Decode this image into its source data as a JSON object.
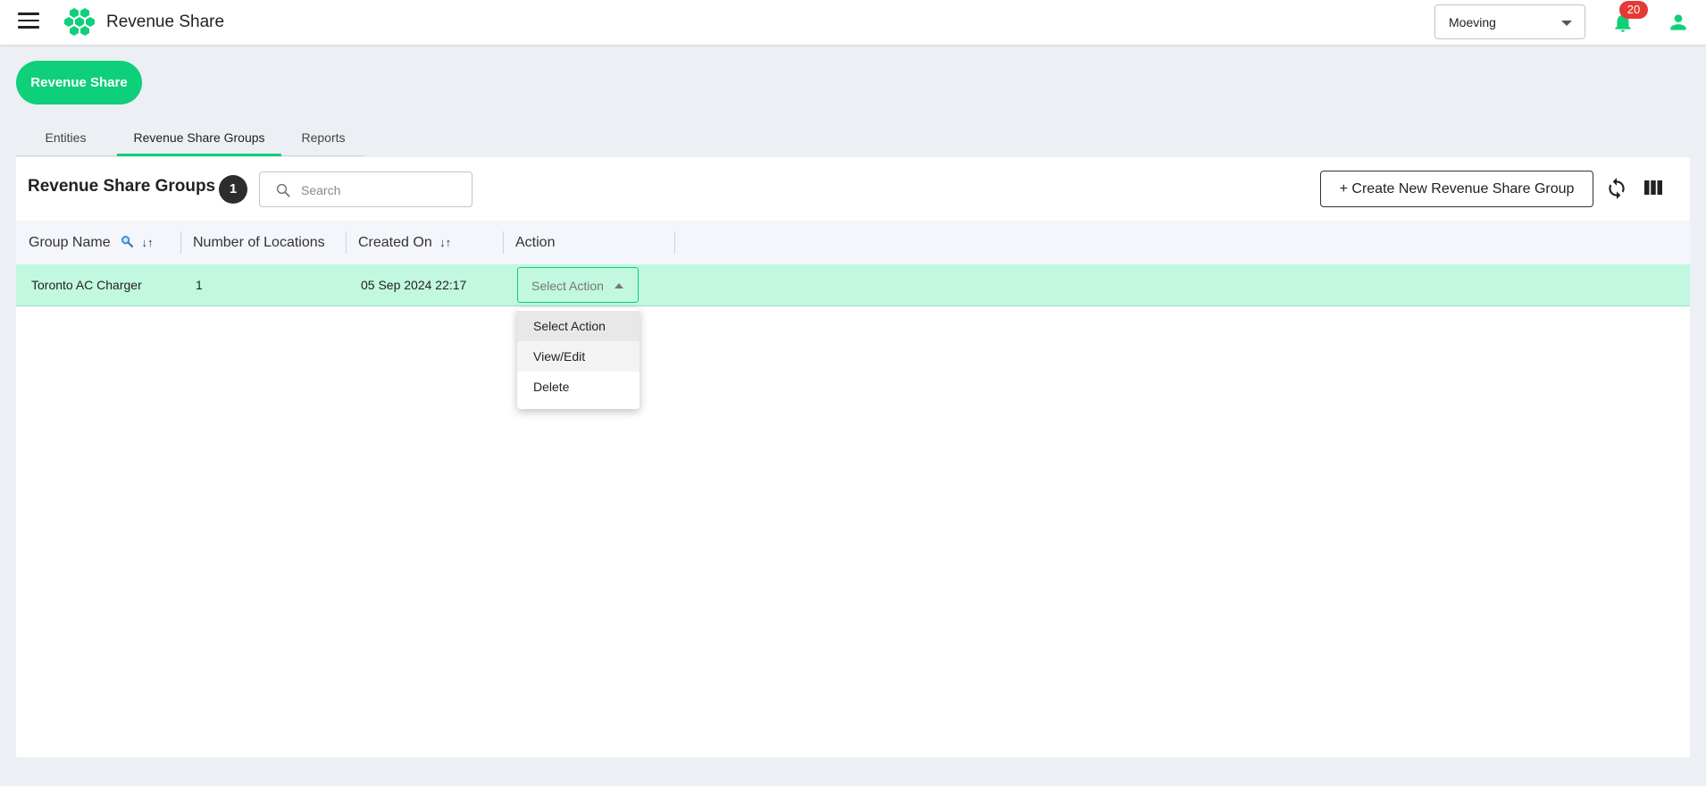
{
  "header": {
    "title": "Revenue Share",
    "org_select": {
      "value": "Moeving"
    },
    "notifications": {
      "count": "20"
    }
  },
  "module": {
    "label": "Revenue Share"
  },
  "tabs": [
    {
      "label": "Entities",
      "active": false
    },
    {
      "label": "Revenue Share Groups",
      "active": true
    },
    {
      "label": "Reports",
      "active": false
    }
  ],
  "toolbar": {
    "title": "Revenue Share Groups",
    "count": "1",
    "search_placeholder": "Search",
    "create_label": "+ Create New Revenue Share Group"
  },
  "table": {
    "columns": [
      {
        "label": "Group Name"
      },
      {
        "label": "Number of Locations"
      },
      {
        "label": "Created On"
      },
      {
        "label": "Action"
      }
    ],
    "rows": [
      {
        "group_name": "Toronto AC Charger",
        "locations": "1",
        "created_on": "05 Sep 2024 22:17",
        "action_placeholder": "Select Action"
      }
    ]
  },
  "action_dropdown": {
    "options": [
      {
        "label": "Select Action",
        "state": "selected"
      },
      {
        "label": "View/Edit",
        "state": "hover"
      },
      {
        "label": "Delete",
        "state": ""
      }
    ]
  },
  "colors": {
    "accent": "#0ecf7a",
    "row_highlight": "#c2f8df",
    "badge_red": "#e53935"
  }
}
